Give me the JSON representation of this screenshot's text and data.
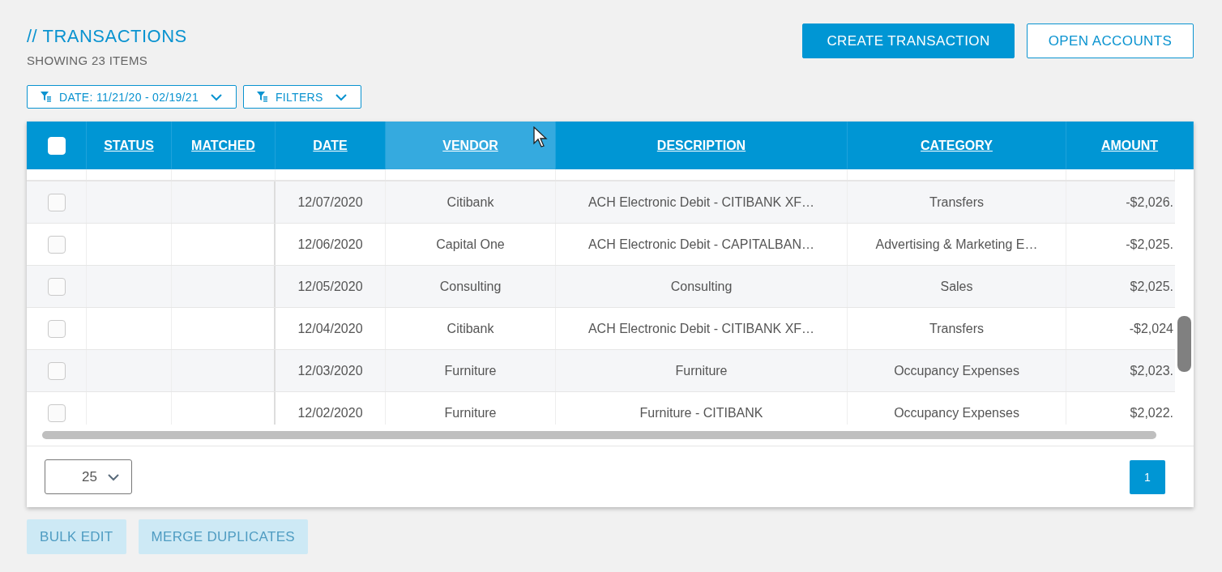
{
  "header": {
    "title": "// TRANSACTIONS",
    "subtitle": "SHOWING 23 ITEMS"
  },
  "actions": [
    {
      "label": "CREATE TRANSACTION",
      "kind": "primary"
    },
    {
      "label": "OPEN ACCOUNTS",
      "kind": "outline"
    }
  ],
  "filters": [
    {
      "label": "DATE: 11/21/20 - 02/19/21"
    },
    {
      "label": "FILTERS"
    }
  ],
  "table": {
    "select_all": {
      "checked": false
    },
    "columns": [
      {
        "label": "STATUS",
        "highlighted": false
      },
      {
        "label": "MATCHED",
        "highlighted": false
      },
      {
        "label": "DATE",
        "highlighted": false
      },
      {
        "label": "VENDOR",
        "highlighted": true
      },
      {
        "label": "DESCRIPTION",
        "highlighted": false
      },
      {
        "label": "CATEGORY",
        "highlighted": false
      },
      {
        "label": "AMOUNT",
        "highlighted": false
      }
    ],
    "rows": [
      {
        "checked": false,
        "date": "12/07/2020",
        "vendor": "Citibank",
        "description": "ACH Electronic Debit - CITIBANK XF…",
        "category": "Transfers",
        "amount": "-$2,026."
      },
      {
        "checked": false,
        "date": "12/06/2020",
        "vendor": "Capital One",
        "description": "ACH Electronic Debit - CAPITALBAN…",
        "category": "Advertising & Marketing E…",
        "amount": "-$2,025."
      },
      {
        "checked": false,
        "date": "12/05/2020",
        "vendor": "Consulting",
        "description": "Consulting",
        "category": "Sales",
        "amount": "$2,025."
      },
      {
        "checked": false,
        "date": "12/04/2020",
        "vendor": "Citibank",
        "description": "ACH Electronic Debit - CITIBANK XF…",
        "category": "Transfers",
        "amount": "-$2,024"
      },
      {
        "checked": false,
        "date": "12/03/2020",
        "vendor": "Furniture",
        "description": "Furniture",
        "category": "Occupancy Expenses",
        "amount": "$2,023."
      },
      {
        "checked": false,
        "date": "12/02/2020",
        "vendor": "Furniture",
        "description": "Furniture - CITIBANK",
        "category": "Occupancy Expenses",
        "amount": "$2,022."
      }
    ]
  },
  "pagination": {
    "page_size": "25",
    "pages": [
      {
        "label": "1",
        "selected": true
      }
    ]
  },
  "bulk_actions": [
    {
      "label": "BULK EDIT",
      "disabled": true
    },
    {
      "label": "MERGE DUPLICATES",
      "disabled": true
    }
  ]
}
